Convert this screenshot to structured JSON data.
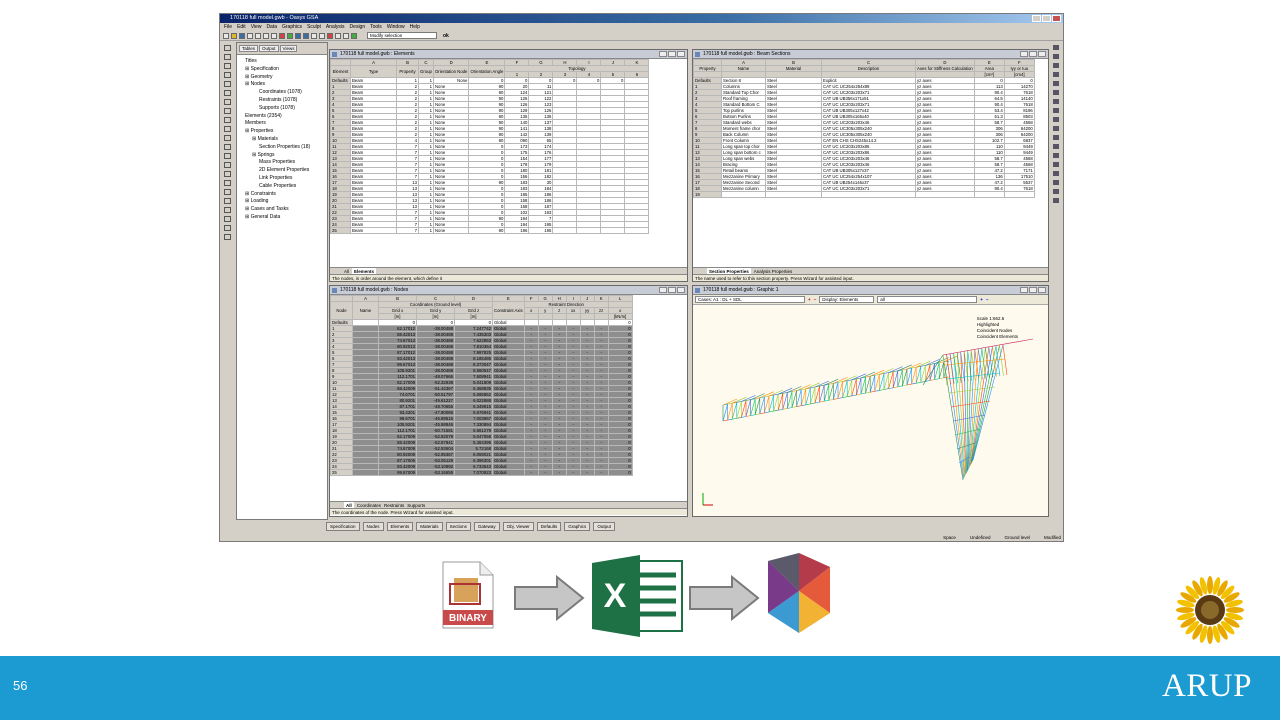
{
  "app": {
    "title": "170118 full model.gwb - Oasys GSA",
    "menu": [
      "File",
      "Edit",
      "View",
      "Data",
      "Graphics",
      "Sculpt",
      "Analysis",
      "Design",
      "Tools",
      "Window",
      "Help"
    ],
    "selection_mode": "Modify selection",
    "ok_label": "ok",
    "status": {
      "space": "Space",
      "undefined": "Undefined",
      "level": "Ground level",
      "modified": "Modified"
    }
  },
  "tree": {
    "tabs": [
      "Tables",
      "Output",
      "Views"
    ],
    "items": [
      "Titles",
      "Specification",
      "Geometry",
      "Nodes",
      "Coordinates (1078)",
      "Restraints (1078)",
      "Supports (1078)",
      "Elements (2354)",
      "Members",
      "Properties",
      "Materials",
      "Section Properties (18)",
      "Springs",
      "Mass Properties",
      "2D Element Properties",
      "Link Properties",
      "Cable Properties",
      "Constraints",
      "Loading",
      "Cases and Tasks",
      "General Data"
    ]
  },
  "elements_window": {
    "title": "170118 full model.gwb : Elements",
    "col_letters": [
      "",
      "A",
      "B",
      "C",
      "D",
      "E",
      "F",
      "G",
      "H",
      "I",
      "J",
      "K"
    ],
    "headers": [
      "Element",
      "Type",
      "Property",
      "Group",
      "Orientation Node",
      "Orientation Angle",
      "1",
      "2",
      "3",
      "4",
      "5",
      "6"
    ],
    "topology_label": "Topology",
    "defaults": [
      "Defaults",
      "Beam",
      "1",
      "1",
      "None",
      "0",
      "0",
      "0",
      "0",
      "0",
      "0",
      ""
    ],
    "types": [
      "Beam",
      "Beam",
      "Beam",
      "Beam",
      "Beam",
      "Beam",
      "Beam",
      "Beam",
      "Beam",
      "Beam",
      "Beam",
      "Beam",
      "Beam",
      "Beam",
      "Beam",
      "Beam",
      "Beam",
      "Beam",
      "Beam",
      "Beam",
      "Beam",
      "Beam",
      "Beam",
      "Beam",
      "Beam"
    ],
    "props": [
      "2",
      "2",
      "2",
      "2",
      "2",
      "2",
      "2",
      "2",
      "2",
      "4",
      "7",
      "7",
      "7",
      "7",
      "7",
      "7",
      "13",
      "13",
      "13",
      "13",
      "13",
      "7",
      "7",
      "7",
      "7"
    ],
    "angles": [
      "90",
      "90",
      "90",
      "90",
      "90",
      "90",
      "90",
      "90",
      "90",
      "90",
      "0",
      "0",
      "0",
      "0",
      "0",
      "0",
      "90",
      "0",
      "0",
      "0",
      "0",
      "0",
      "90",
      "0",
      "90"
    ],
    "node1": [
      "20",
      "124",
      "125",
      "126",
      "129",
      "135",
      "140",
      "141",
      "142",
      "090",
      "173",
      "175",
      "154",
      "178",
      "180",
      "156",
      "183",
      "183",
      "185",
      "158",
      "158",
      "102",
      "194",
      "194",
      "196"
    ],
    "node2": [
      "11",
      "121",
      "122",
      "123",
      "126",
      "136",
      "137",
      "138",
      "139",
      "65",
      "174",
      "176",
      "177",
      "179",
      "181",
      "182",
      "30",
      "184",
      "186",
      "186",
      "187",
      "193",
      "7",
      "195",
      "195"
    ],
    "tabs": [
      "All",
      "Elements"
    ],
    "status": "The nodes, in order around the element, which define it"
  },
  "sections_window": {
    "title": "170118 full model.gwb : Beam Sections",
    "col_letters": [
      "",
      "A",
      "B",
      "C",
      "D",
      "E",
      "F"
    ],
    "headers": [
      "Property",
      "Name",
      "Material",
      "Description",
      "Axes for Stiffness Calculation",
      "Area",
      "Iyy or Iuu"
    ],
    "units": [
      "",
      "",
      "",
      "",
      "",
      "[cm²]",
      "[cm4]"
    ],
    "defaults": [
      "Defaults",
      "Section 8",
      "Steel",
      "Explicit",
      "yz axes",
      "0",
      "0"
    ],
    "names": [
      "Columns",
      "Standard Top Chor",
      "Roof framing",
      "Standard Bottom C",
      "Top purlins",
      "Bottom Purlins",
      "Standard webs",
      "Moment frame chor",
      "Back Column",
      "Front Column",
      "Long span top chor",
      "Long span bottom c",
      "Long span webs",
      "Bracing",
      "Retail beams",
      "Mezzanine Primary",
      "Mezzanine Second",
      "Mezzanine column"
    ],
    "descs": [
      "CAT UC UC254x254x89",
      "CAT UC UC203x203x71",
      "CAT UB UB356x171x51",
      "CAT UC UC203x203x71",
      "CAT UB UB305x127x42",
      "CAT UB UB305x165x40",
      "CAT UC UC203x203x46",
      "CAT UC UC305x305x240",
      "CAT UC UC305x305x240",
      "CAT EN CHS CHS245x14.2",
      "CAT UC UC203x203x86",
      "CAT UC UC203x203x86",
      "CAT UC UC203x203x46",
      "CAT UC UC203x203x46",
      "CAT UB UB305x127x37",
      "CAT UC UC254x254x107",
      "CAT UB UB254x146x37",
      "CAT UC UC203x203x71"
    ],
    "areas": [
      "113",
      "90.4",
      "64.5",
      "90.4",
      "53.4",
      "51.3",
      "58.7",
      "306",
      "306",
      "102.7",
      "110",
      "110",
      "58.7",
      "58.7",
      "47.2",
      "136",
      "47.2",
      "90.4"
    ],
    "iyys": [
      "14270",
      "7618",
      "14140",
      "7618",
      "8196",
      "8503",
      "4568",
      "64200",
      "64200",
      "6837",
      "9449",
      "9449",
      "4568",
      "4568",
      "7171",
      "17510",
      "5537",
      "7618"
    ],
    "tabs": [
      "Section Properties",
      "Analysis Properties"
    ],
    "status": "The name used to refer to this section property. Press Wizard for assisted input."
  },
  "nodes_window": {
    "title": "170118 full model.gwb : Nodes",
    "col_letters": [
      "",
      "A",
      "B",
      "C",
      "D",
      "E",
      "F",
      "G",
      "H",
      "I",
      "J",
      "K",
      "L"
    ],
    "coord_group": "Coordinates (Ground level)",
    "restraint_group": "Restraint Direction",
    "headers": [
      "Node",
      "Name",
      "Grid x",
      "Grid y",
      "Grid z",
      "Constraint Axis",
      "x",
      "y",
      "z",
      "xx",
      "yy",
      "zz",
      "x"
    ],
    "units": [
      "",
      "",
      "[m]",
      "[m]",
      "[m]",
      "",
      "",
      "",
      "",
      "",
      "",
      "",
      "[kN/m]"
    ],
    "defaults": [
      "Defaults",
      "",
      "0",
      "0",
      "0",
      "Global",
      "",
      "",
      "",
      "",
      "",
      "",
      "0"
    ],
    "gx": [
      "62.17012",
      "68.42013",
      "74.67013",
      "80.92013",
      "87.17012",
      "93.42013",
      "99.67013",
      "105.9201",
      "112.1701",
      "62.17009",
      "68.42009",
      "74.6701",
      "80.9201",
      "87.1701",
      "93.4201",
      "99.6701",
      "105.9201",
      "112.1701",
      "62.17009",
      "68.42009",
      "74.67009",
      "80.92009",
      "87.17006",
      "93.42009",
      "99.67009"
    ],
    "gy": [
      "-38.00488",
      "-38.00488",
      "-38.00488",
      "-38.00488",
      "-38.00488",
      "-38.00488",
      "-38.00488",
      "-38.00488",
      "-48.07666",
      "-52.32938",
      "-51.42367",
      "-50.51797",
      "-49.61227",
      "-48.70656",
      "-47.80086",
      "-46.89516",
      "-45.98946",
      "-50.71581",
      "-52.82079",
      "-52.87841",
      "-52.93604",
      "-52.95367",
      "-53.05129",
      "-53.10892",
      "-53.16655"
    ],
    "gz": [
      "7.247742",
      "7.435303",
      "7.622863",
      "7.810364",
      "7.997825",
      "8.185486",
      "8.373047",
      "8.560547",
      "7.608941",
      "5.041809",
      "5.368835",
      "5.695862",
      "6.022888",
      "6.349915",
      "6.676941",
      "7.003967",
      "7.330994",
      "6.561279",
      "5.047058",
      "5.384399",
      "5.72168",
      "6.059021",
      "6.396301",
      "6.733643",
      "7.070923"
    ],
    "tabs": [
      "All",
      "Coordinates",
      "Restraints",
      "Supports"
    ],
    "status": "The coordinates of the node. Press Wizard for assisted input."
  },
  "graphic_window": {
    "title": "170118 full model.gwb : Graphic 1",
    "cases": "Cases: A1 : DL + SDL",
    "display_label": "Display: Elements",
    "display_scope": "all",
    "labels": [
      "Scale 1:662.6",
      "Highlighted",
      "Coincident Nodes",
      "Coincident Elements"
    ]
  },
  "bottom_tabs": [
    "Specification",
    "Nodes",
    "Elements",
    "Materials",
    "Sections",
    "Gateway",
    "Obj. Viewer",
    "Defaults",
    "Graphics",
    "Output"
  ],
  "workflow": {
    "binary_label": "BINARY",
    "excel_letter": "X"
  },
  "slide": {
    "page_number": "56",
    "brand": "ARUP",
    "footer_color": "#1b9bd1"
  }
}
